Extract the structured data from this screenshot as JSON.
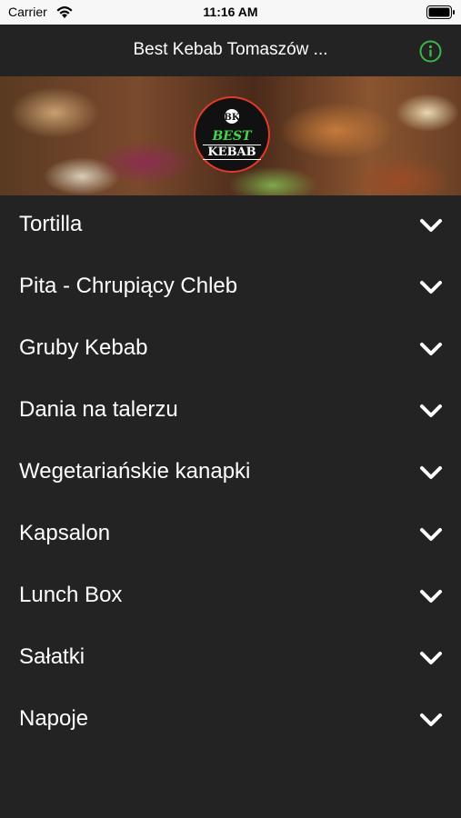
{
  "status_bar": {
    "carrier": "Carrier",
    "time": "11:16 AM"
  },
  "nav": {
    "title": "Best Kebab Tomaszów ...",
    "info_icon": "info-circle-icon",
    "info_color": "#3cb54a"
  },
  "banner": {
    "logo_line1": "BEST",
    "logo_line2": "KEBAB"
  },
  "menu": {
    "items": [
      {
        "label": "Tortilla"
      },
      {
        "label": "Pita - Chrupiący Chleb"
      },
      {
        "label": "Gruby Kebab"
      },
      {
        "label": "Dania na talerzu"
      },
      {
        "label": "Wegetariańskie kanapki"
      },
      {
        "label": "Kapsalon"
      },
      {
        "label": "Lunch Box"
      },
      {
        "label": "Sałatki"
      },
      {
        "label": "Napoje"
      }
    ],
    "chevron_icon": "chevron-down-icon"
  },
  "colors": {
    "background": "#232323",
    "text": "#ffffff",
    "accent": "#3cb54a"
  }
}
